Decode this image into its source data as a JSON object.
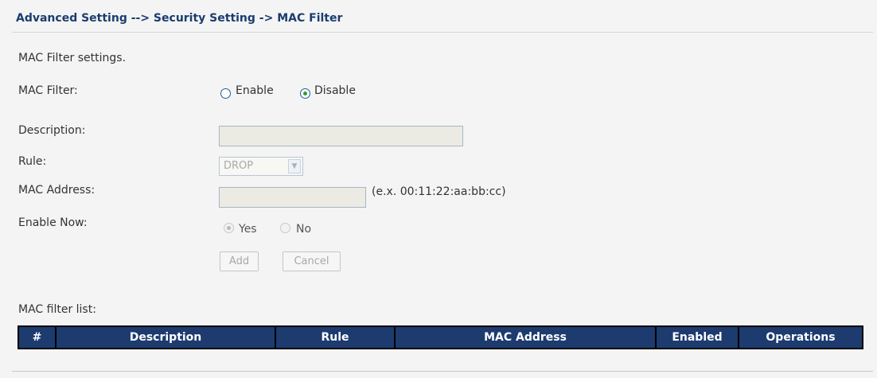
{
  "breadcrumb": "Advanced Setting --> Security Setting -> MAC Filter",
  "section_title": "MAC Filter settings.",
  "mac_filter": {
    "label": "MAC Filter:",
    "options": [
      "Enable",
      "Disable"
    ],
    "selected": "Disable"
  },
  "description": {
    "label": "Description:",
    "value": ""
  },
  "rule": {
    "label": "Rule:",
    "selected": "DROP"
  },
  "mac_address": {
    "label": "MAC Address:",
    "value": "",
    "hint": "(e.x. 00:11:22:aa:bb:cc)"
  },
  "enable_now": {
    "label": "Enable Now:",
    "options": [
      "Yes",
      "No"
    ],
    "selected": "Yes"
  },
  "buttons": {
    "add": "Add",
    "cancel": "Cancel"
  },
  "list": {
    "label": "MAC filter list:",
    "columns": [
      "#",
      "Description",
      "Rule",
      "MAC Address",
      "Enabled",
      "Operations"
    ],
    "rows": []
  },
  "colors": {
    "header_bg": "#1d3b6f",
    "breadcrumb": "#1a3d6e",
    "page_bg": "#f4f4f4"
  }
}
